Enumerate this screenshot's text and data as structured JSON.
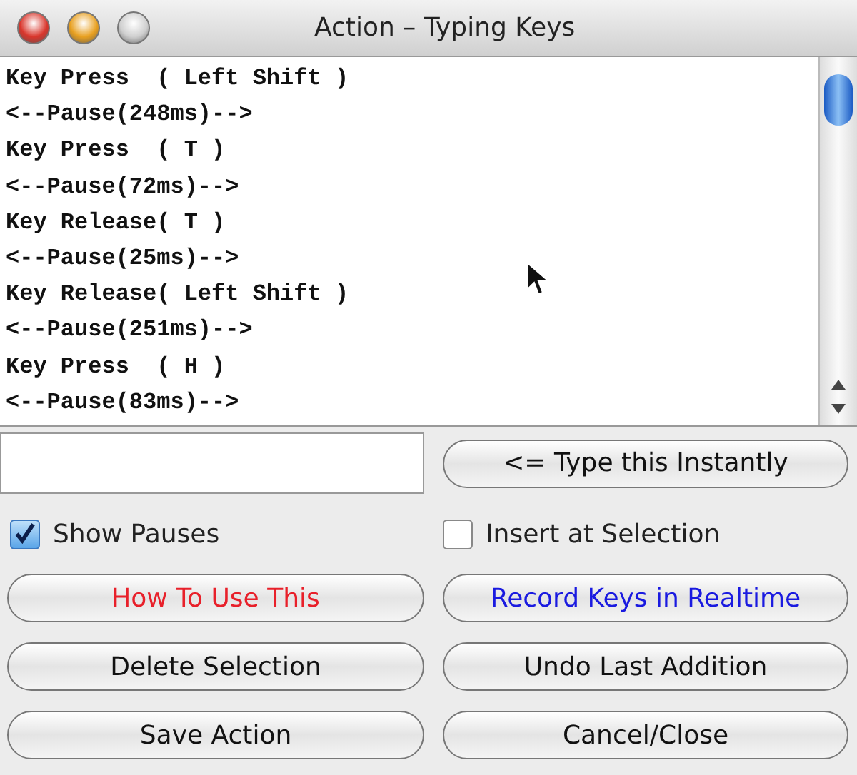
{
  "window": {
    "title": "Action – Typing Keys"
  },
  "log": {
    "lines": [
      "Key Press  ( Left Shift )",
      "<--Pause(248ms)-->",
      "Key Press  ( T )",
      "<--Pause(72ms)-->",
      "Key Release( T )",
      "<--Pause(25ms)-->",
      "Key Release( Left Shift )",
      "<--Pause(251ms)-->",
      "Key Press  ( H )",
      "<--Pause(83ms)-->"
    ]
  },
  "type_button": {
    "label": "<= Type this Instantly"
  },
  "checkboxes": [
    {
      "label": "Show Pauses",
      "checked": true
    },
    {
      "label": "Insert at Selection",
      "checked": false
    }
  ],
  "buttons": [
    {
      "label": "How To Use This",
      "color": "#e8202a"
    },
    {
      "label": "Record Keys in Realtime",
      "color": "#1a1ae0"
    },
    {
      "label": "Delete Selection"
    },
    {
      "label": "Undo Last Addition"
    },
    {
      "label": "Save Action"
    },
    {
      "label": "Cancel/Close"
    }
  ]
}
